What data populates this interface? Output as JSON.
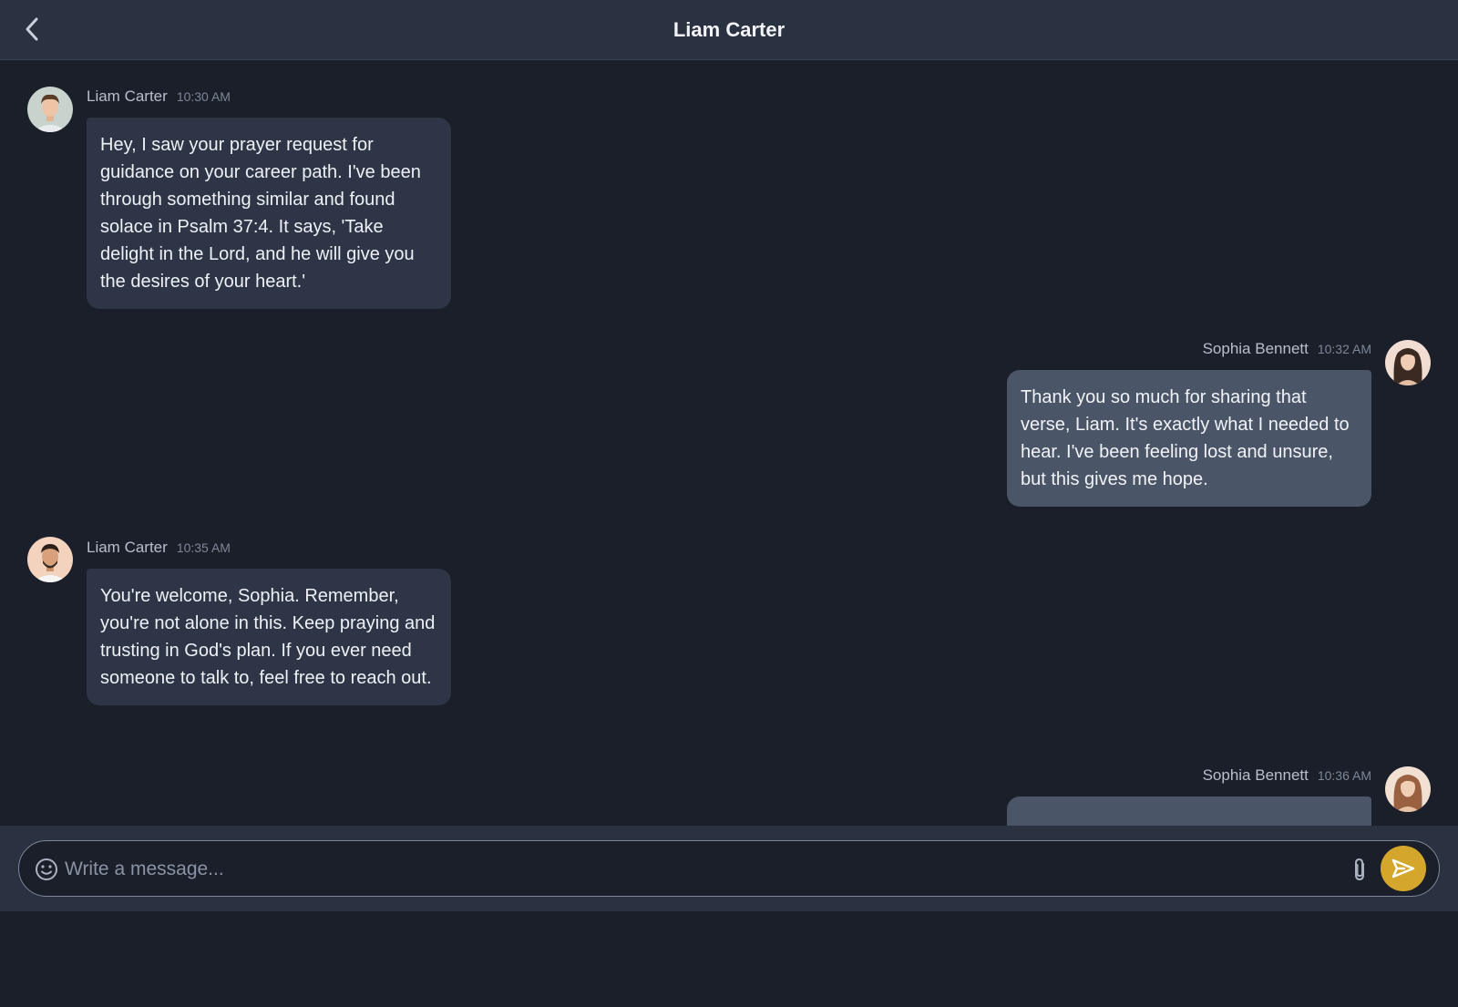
{
  "header": {
    "title": "Liam Carter",
    "back_icon": "chevron-left-icon"
  },
  "messages": [
    {
      "direction": "incoming",
      "sender": "Liam Carter",
      "time": "10:30 AM",
      "text": "Hey, I saw your prayer request for guidance on your career path. I've been through something similar and found solace in Psalm 37:4. It says, 'Take delight in the Lord, and he will give you the desires of your heart.'"
    },
    {
      "direction": "outgoing",
      "sender": "Sophia Bennett",
      "time": "10:32 AM",
      "text": "Thank you so much for sharing that verse, Liam. It's exactly what I needed to hear. I've been feeling lost and unsure, but this gives me hope."
    },
    {
      "direction": "incoming",
      "sender": "Liam Carter",
      "time": "10:35 AM",
      "text": "You're welcome, Sophia. Remember, you're not alone in this. Keep praying and trusting in God's plan. If you ever need someone to talk to, feel free to reach out."
    },
    {
      "direction": "outgoing",
      "sender": "Sophia Bennett",
      "time": "10:36 AM",
      "text": ""
    }
  ],
  "composer": {
    "placeholder": "Write a message...",
    "value": "",
    "emoji_icon": "smiley-icon",
    "attach_icon": "paperclip-icon",
    "send_icon": "send-icon"
  },
  "colors": {
    "background": "#1b1f2a",
    "header": "#2a3242",
    "incoming_bubble": "#2d3546",
    "outgoing_bubble": "#4a5568",
    "accent": "#d4a72c"
  }
}
